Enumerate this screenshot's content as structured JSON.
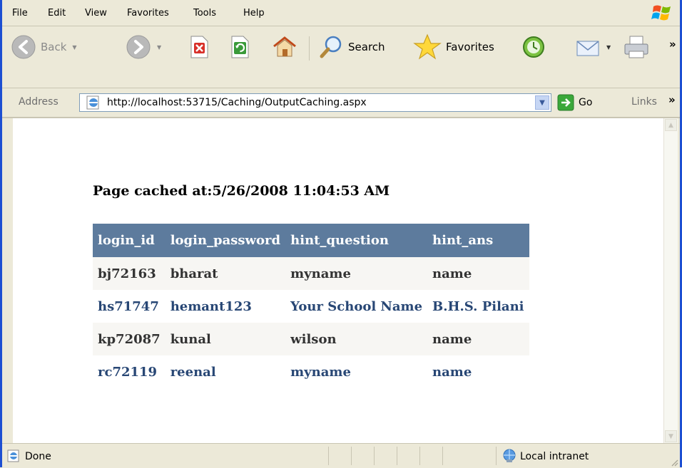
{
  "menu": [
    "File",
    "Edit",
    "View",
    "Favorites",
    "Tools",
    "Help"
  ],
  "toolbar": {
    "back_label": "Back",
    "search_label": "Search",
    "favorites_label": "Favorites"
  },
  "address": {
    "label": "Address",
    "url": "http://localhost:53715/Caching/OutputCaching.aspx",
    "go_label": "Go",
    "links_label": "Links",
    "overflow": "»"
  },
  "page": {
    "cache_text": "Page cached at:5/26/2008 11:04:53 AM"
  },
  "table": {
    "headers": [
      "login_id",
      "login_password",
      "hint_question",
      "hint_ans"
    ],
    "rows": [
      [
        "bj72163",
        "bharat",
        "myname",
        "name"
      ],
      [
        "hs71747",
        "hemant123",
        "Your School Name",
        "B.H.S. Pilani"
      ],
      [
        "kp72087",
        "kunal",
        "wilson",
        "name"
      ],
      [
        "rc72119",
        "reenal",
        "myname",
        "name"
      ]
    ]
  },
  "status": {
    "text": "Done",
    "zone": "Local intranet"
  },
  "colors": {
    "header_bg": "#5d7b9d",
    "row_alt_bg": "#f7f6f3",
    "row_text_dark": "#333333",
    "row_text_blue": "#284775",
    "window_border": "#1d4fd2"
  }
}
